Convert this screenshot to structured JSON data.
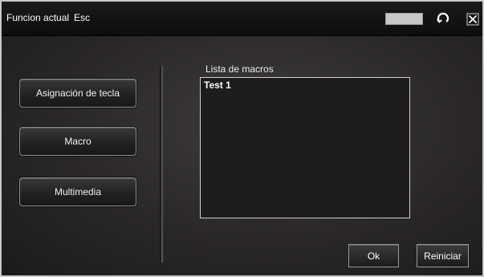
{
  "titlebar": {
    "label": "Funcion actual",
    "current_key": "Esc",
    "icons": {
      "refresh": "refresh-icon",
      "close": "close-icon"
    }
  },
  "sidebar": {
    "buttons": [
      {
        "label": "Asignación de tecla"
      },
      {
        "label": "Macro"
      },
      {
        "label": "Multimedia"
      }
    ]
  },
  "macros": {
    "title": "Lista de macros",
    "items": [
      "Test 1"
    ]
  },
  "footer": {
    "ok_label": "Ok",
    "reset_label": "Reiniciar"
  },
  "colors": {
    "background": "#2a2728",
    "titlebar": "#111111",
    "text": "#ffffff",
    "button_border": "#8e8e8e"
  }
}
